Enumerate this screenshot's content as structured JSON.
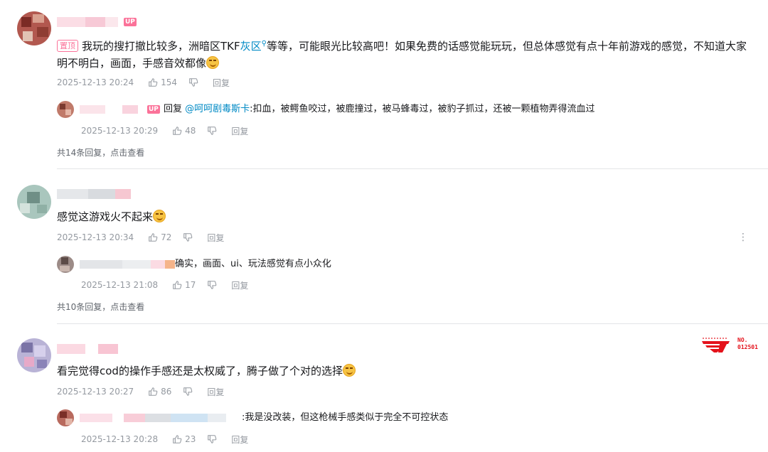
{
  "colors": {
    "up_badge": "#fb7299",
    "mention": "#008ac5",
    "top_tag": "#fb7299",
    "meta_text": "#9499a0",
    "team_logo": "#e4121b"
  },
  "comments": [
    {
      "up_badge": "UP",
      "top_tag": "置顶",
      "text_before_mention": "我玩的搜打撤比较多，洲暗区TKF",
      "search_keyword": "灰区",
      "text_after_mention": "等等，可能眼光比较高吧！如果免费的话感觉能玩玩，但总体感觉有点十年前游戏的感觉，不知道大家明不明白，画面，手感音效都像",
      "time": "2025-12-13 20:24",
      "likes": "154",
      "reply_label": "回复",
      "replies": [
        {
          "up_badge": "UP",
          "prefix": "回复 ",
          "mention": "@呵呵剧毒斯卡",
          "text": ":扣血，被鳄鱼咬过，被鹿撞过，被马蜂毒过，被豹子抓过，还被一颗植物弄得流血过",
          "time": "2025-12-13 20:29",
          "likes": "48",
          "reply_label": "回复"
        }
      ],
      "more_replies": "共14条回复，点击查看"
    },
    {
      "text": "感觉这游戏火不起来",
      "time": "2025-12-13 20:34",
      "likes": "72",
      "reply_label": "回复",
      "more_icon": "⋮",
      "replies": [
        {
          "text": "确实，画面、ui、玩法感觉有点小众化",
          "time": "2025-12-13 21:08",
          "likes": "17",
          "reply_label": "回复"
        }
      ],
      "more_replies": "共10条回复，点击查看"
    },
    {
      "text": "看完觉得cod的操作手感还是太权威了，腾子做了个对的选择",
      "time": "2025-12-13 20:27",
      "likes": "86",
      "reply_label": "回复",
      "badge_no": "NO.",
      "badge_num": "012501",
      "replies": [
        {
          "text": ":我是没改装，但这枪械手感类似于完全不可控状态",
          "time": "2025-12-13 20:28",
          "likes": "23",
          "reply_label": "回复"
        }
      ]
    }
  ]
}
